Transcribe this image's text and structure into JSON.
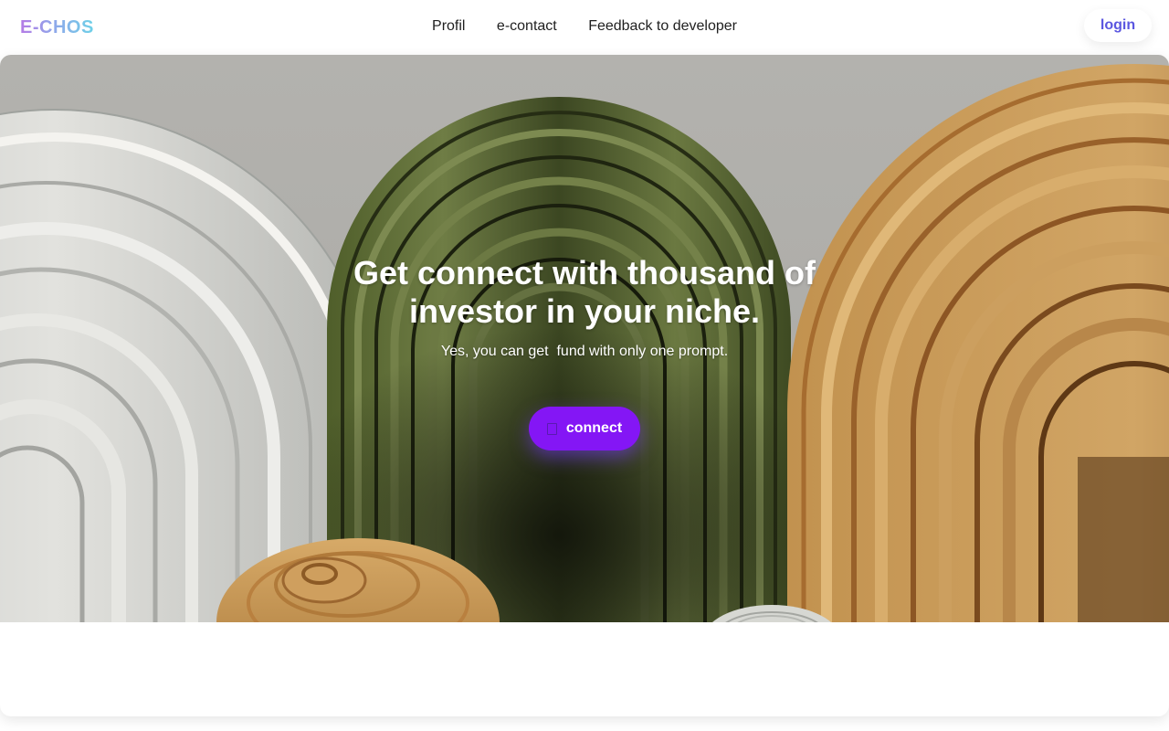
{
  "navbar": {
    "logo": "E-CHOS",
    "links": [
      "Profil",
      "e-contact",
      "Feedback to developer"
    ],
    "login_label": "login"
  },
  "hero": {
    "title": "Get connect with thousand of investor in your niche.",
    "subtitle": "Yes, you can get  fund with only one prompt.",
    "cta_label": "connect",
    "cta_icon": "connect-icon"
  },
  "colors": {
    "accent": "#8416f5",
    "login_text": "#5b57e0",
    "logo_gradient": [
      "#b57be6",
      "#8fa6ea",
      "#6ed1e8"
    ]
  }
}
